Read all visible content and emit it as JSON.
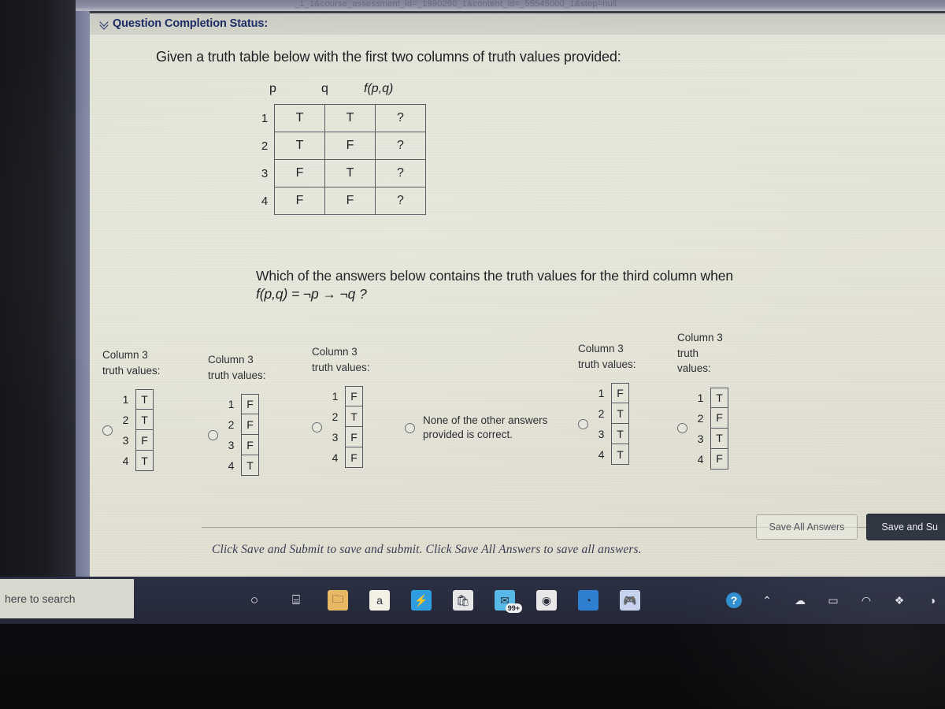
{
  "browser": {
    "url_fragment": "_1_1&course_assessment_id=_1990290_1&content_id=_55545000_1&step=null"
  },
  "header": {
    "status_label": "Question Completion Status:",
    "chevron_icon": "chevron-double-down-icon"
  },
  "question": {
    "prompt": "Given a truth table below with the first two columns of truth values provided:",
    "table": {
      "headers": [
        "p",
        "q",
        "f(p,q)"
      ],
      "rows": [
        {
          "n": "1",
          "p": "T",
          "q": "T",
          "f": "?"
        },
        {
          "n": "2",
          "p": "T",
          "q": "F",
          "f": "?"
        },
        {
          "n": "3",
          "p": "F",
          "q": "T",
          "f": "?"
        },
        {
          "n": "4",
          "p": "F",
          "q": "F",
          "f": "?"
        }
      ]
    },
    "ask_line1": "Which of the answers below contains  the truth values for the third column when",
    "ask_line2": "f(p,q) = ¬p → ¬q ?"
  },
  "options": [
    {
      "id": "option-1",
      "label": "Column 3\ntruth values:",
      "values": [
        {
          "n": "1",
          "v": "T"
        },
        {
          "n": "2",
          "v": "T"
        },
        {
          "n": "3",
          "v": "F"
        },
        {
          "n": "4",
          "v": "T"
        }
      ],
      "selected": false
    },
    {
      "id": "option-2",
      "label": "Column 3\ntruth values:",
      "values": [
        {
          "n": "1",
          "v": "F"
        },
        {
          "n": "2",
          "v": "F"
        },
        {
          "n": "3",
          "v": "F"
        },
        {
          "n": "4",
          "v": "T"
        }
      ],
      "selected": false
    },
    {
      "id": "option-3",
      "label": "Column 3\ntruth values:",
      "values": [
        {
          "n": "1",
          "v": "F"
        },
        {
          "n": "2",
          "v": "T"
        },
        {
          "n": "3",
          "v": "F"
        },
        {
          "n": "4",
          "v": "F"
        }
      ],
      "selected": false
    },
    {
      "id": "option-4",
      "label": "",
      "text": "None of the other answers\nprovided is correct.",
      "values": [],
      "selected": false
    },
    {
      "id": "option-5",
      "label": "Column 3\ntruth values:",
      "values": [
        {
          "n": "1",
          "v": "F"
        },
        {
          "n": "2",
          "v": "T"
        },
        {
          "n": "3",
          "v": "T"
        },
        {
          "n": "4",
          "v": "T"
        }
      ],
      "selected": false
    },
    {
      "id": "option-6",
      "label": "Column 3\ntruth\nvalues:",
      "values": [
        {
          "n": "1",
          "v": "T"
        },
        {
          "n": "2",
          "v": "F"
        },
        {
          "n": "3",
          "v": "T"
        },
        {
          "n": "4",
          "v": "F"
        }
      ],
      "selected": false
    }
  ],
  "footer": {
    "note": "Click Save and Submit to save and submit. Click Save All Answers to save all answers.",
    "save_all_label": "Save All Answers",
    "save_submit_label": "Save and Su"
  },
  "taskbar": {
    "search_placeholder": "here to search",
    "icons": [
      {
        "name": "cortana-icon",
        "glyph": "○"
      },
      {
        "name": "task-view-icon",
        "glyph": "⌸"
      },
      {
        "name": "file-explorer-icon",
        "glyph": "🗀"
      },
      {
        "name": "amazon-icon",
        "glyph": "a"
      },
      {
        "name": "lightning-icon",
        "glyph": "⚡"
      },
      {
        "name": "microsoft-store-icon",
        "glyph": "🛍"
      },
      {
        "name": "mail-icon",
        "glyph": "✉",
        "badge": "99+"
      },
      {
        "name": "chrome-icon",
        "glyph": "◉"
      },
      {
        "name": "edge-icon",
        "glyph": "◔"
      },
      {
        "name": "discord-icon",
        "glyph": "🎮"
      }
    ],
    "tray": [
      {
        "name": "help-icon",
        "glyph": "?"
      },
      {
        "name": "chevron-up-icon",
        "glyph": "⌃"
      },
      {
        "name": "onedrive-icon",
        "glyph": "☁"
      },
      {
        "name": "battery-icon",
        "glyph": "▭"
      },
      {
        "name": "wifi-icon",
        "glyph": "◠"
      },
      {
        "name": "dropbox-icon",
        "glyph": "❖"
      },
      {
        "name": "more-tray-icon",
        "glyph": "◑"
      }
    ]
  },
  "colors": {
    "accent_header_text": "#1c2a63",
    "page_bg": "#e4e5d8",
    "taskbar_bg": "#262a3a",
    "dark_button": "#2e3340"
  }
}
